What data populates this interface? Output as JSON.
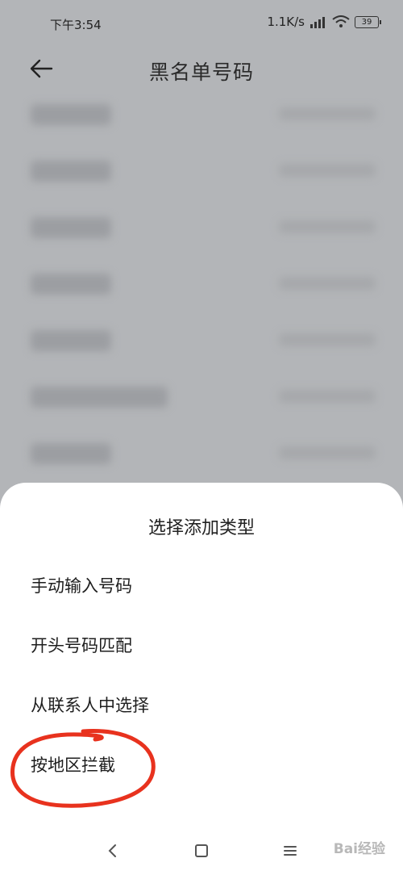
{
  "status_bar": {
    "time": "下午3:54",
    "net_speed": "1.1K/s",
    "battery": "39"
  },
  "header": {
    "title": "黑名单号码"
  },
  "sheet": {
    "title": "选择添加类型",
    "options": [
      {
        "label": "手动输入号码"
      },
      {
        "label": "开头号码匹配"
      },
      {
        "label": "从联系人中选择"
      },
      {
        "label": "按地区拦截"
      }
    ],
    "highlight_color": "#e8321e"
  },
  "watermark": {
    "text": "Bai经验"
  }
}
